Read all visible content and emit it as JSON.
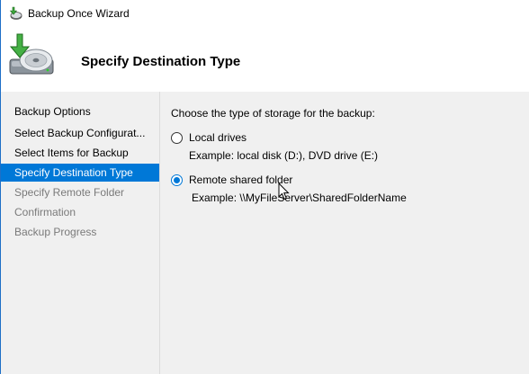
{
  "window": {
    "title": "Backup Once Wizard"
  },
  "header": {
    "title": "Specify Destination Type"
  },
  "sidebar": {
    "steps": [
      {
        "label": "Backup Options",
        "state": "done"
      },
      {
        "label": "Select Backup Configurat...",
        "state": "done"
      },
      {
        "label": "Select Items for Backup",
        "state": "done"
      },
      {
        "label": "Specify Destination Type",
        "state": "active"
      },
      {
        "label": "Specify Remote Folder",
        "state": "pending"
      },
      {
        "label": "Confirmation",
        "state": "pending"
      },
      {
        "label": "Backup Progress",
        "state": "pending"
      }
    ]
  },
  "main": {
    "prompt": "Choose the type of storage for the backup:",
    "options": [
      {
        "label": "Local drives",
        "example": "Example: local disk (D:), DVD drive (E:)",
        "selected": false
      },
      {
        "label": "Remote shared folder",
        "example": "Example: \\\\MyFileServer\\SharedFolderName",
        "selected": true
      }
    ]
  },
  "colors": {
    "accent": "#0078d7",
    "sidebar_bg": "#f0f0f0",
    "disabled_text": "#7a7a7a"
  },
  "icons": {
    "title": "backup-wizard-icon",
    "header": "backup-disk-icon",
    "pointer": "mouse-cursor-icon"
  }
}
